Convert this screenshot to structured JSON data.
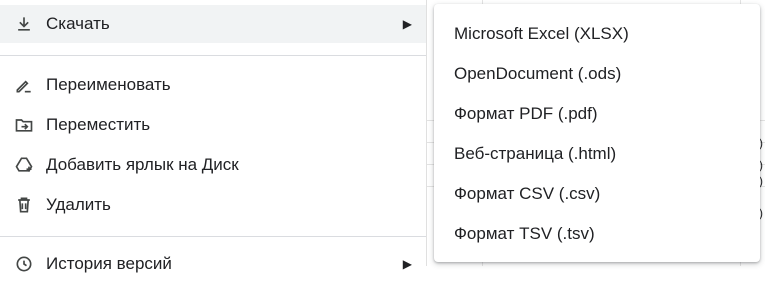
{
  "menu": {
    "download": "Скачать",
    "rename": "Переименовать",
    "move": "Переместить",
    "add_shortcut": "Добавить ярлык на Диск",
    "delete": "Удалить",
    "version_history": "История версий"
  },
  "submenu": {
    "items": [
      "Microsoft Excel (XLSX)",
      "OpenDocument (.ods)",
      "Формат PDF (.pdf)",
      "Веб-страница (.html)",
      "Формат CSV (.csv)",
      "Формат TSV (.tsv)"
    ]
  },
  "background": {
    "cell_fragments": [
      ")",
      ")",
      ")",
      ")"
    ]
  },
  "colors": {
    "active_row": "#f1f3f4",
    "text": "#202124",
    "separator": "#dadce0"
  }
}
